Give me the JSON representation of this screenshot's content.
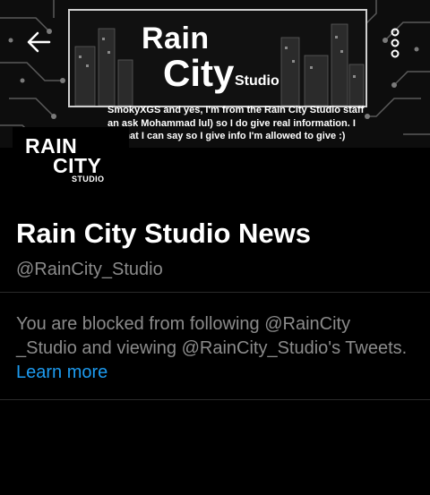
{
  "header": {
    "banner_brand": {
      "rain": "Rain",
      "city": "City",
      "studio": "Studio"
    },
    "banner_text": "SmokyXGS and yes, I'm from the Rain City Studio staff\nan ask Mohammad lul)  so I do give real information. I\nn what I can say so I give info I'm allowed to give :)",
    "back_icon": "arrow-left-icon",
    "menu_icon": "more-vertical-icon"
  },
  "avatar": {
    "line1": "RAIN",
    "line2": "CITY",
    "line3": "STUDIO"
  },
  "profile": {
    "name": "Rain City Studio News",
    "handle": "@RainCity_Studio"
  },
  "notice": {
    "text": "You are blocked from following @RainCity _Studio and viewing @RainCity_Studio's Tweets.",
    "link": "Learn more",
    "link_color": "#1d9bf0"
  }
}
